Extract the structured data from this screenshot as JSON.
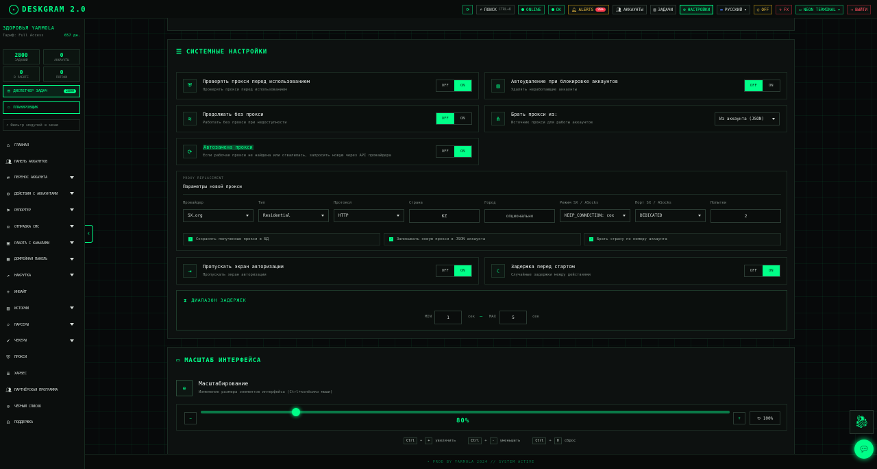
{
  "app": {
    "title": "DESKGRAM 2.0"
  },
  "topbar": {
    "search": "ПОИСК",
    "search_kbd": "CTRL+K",
    "online": "ONLINE",
    "ok": "OK",
    "alerts": "ALERTS",
    "alerts_badge": "99+",
    "accounts": "АККАУНТЫ",
    "tasks": "ЗАДАЧИ",
    "settings": "НАСТРОЙКИ",
    "language": "РУССКИЙ",
    "off": "OFF",
    "fx": "FX",
    "theme": "NEON TERMINAL",
    "logout": "ВЫЙТИ"
  },
  "sidebar": {
    "user": "ЗДОРОВЬЯ YARMOLA",
    "tariff": "Тариф: Full Access",
    "days": "657 дн.",
    "stats": [
      {
        "value": "2800",
        "label": "ЗАДАНИЙ"
      },
      {
        "value": "0",
        "label": "АККАУНТЫ"
      },
      {
        "value": "0",
        "label": "В РАБОТЕ"
      },
      {
        "value": "0",
        "label": "ПОТОКИ"
      }
    ],
    "dispatcher": "ДИСПЕТЧЕР ЗАДАЧ",
    "dispatcher_badge": "2800",
    "scheduler": "ПЛАНИРОВЩИК",
    "filter_placeholder": "Фильтр модулей в меню",
    "nav": [
      "ГЛАВНАЯ",
      "ПАНЕЛЬ АККАУНТОВ",
      "ПЕРЕНОС АККАУНТА",
      "ДЕЙСТВИЯ С АККАУНТАМИ",
      "РЕПОРТЕР",
      "ОТПРАВКА СМС",
      "РАБОТА С КАНАЛАМИ",
      "ДОМРЕЙНАЯ ПАНЕЛЬ",
      "НАКРУТКА",
      "ИНВАЙТ",
      "ИСТОРИИ",
      "ПАРСЕРЫ",
      "ЧЕКЕРЫ",
      "ПРОКСИ",
      "ХАРВЕС",
      "ПАРТНЁРСКАЯ ПРОГРАММА",
      "ЧЁРНЫЙ СПИСОК",
      "ПОДДЕРЖКА"
    ]
  },
  "system": {
    "title": "СИСТЕМНЫЕ НАСТРОЙКИ",
    "cards": [
      {
        "title": "Проверять прокси перед использованием",
        "sub": "Проверять прокси перед использованием",
        "off": "OFF",
        "on": "ON",
        "state": "on"
      },
      {
        "title": "Автоудаление при блокировке аккаунтов",
        "sub": "Удалять неработающие аккаунты",
        "off": "OFF",
        "on": "ON",
        "state": "off"
      },
      {
        "title": "Продолжать без прокси",
        "sub": "Работать без прокси при недоступности",
        "off": "OFF",
        "on": "ON",
        "state": "off"
      },
      {
        "title": "Брать прокси из:",
        "sub": "Источник прокси для работы аккаунтов",
        "select": "Из аккаунта (JSON)"
      },
      {
        "title": "Автозамена прокси",
        "sub": "Если рабочая прокси не найдена или отвалилась, запросить новую через API провайдера",
        "off": "OFF",
        "on": "ON",
        "state": "on"
      }
    ],
    "replacement": {
      "tag": "PROXY REPLACEMENT",
      "title": "Параметры новой прокси",
      "fields": [
        {
          "label": "Провайдер",
          "value": "SX.org"
        },
        {
          "label": "Тип",
          "value": "Residential"
        },
        {
          "label": "Протокол",
          "value": "HTTP"
        },
        {
          "label": "Страна",
          "value": "KZ"
        },
        {
          "label": "Город",
          "value": "опционально"
        },
        {
          "label": "Режим SX / ASocks",
          "value": "KEEP_CONNECTION: cox"
        },
        {
          "label": "Порт SX / ASocks",
          "value": "DEDICATED"
        },
        {
          "label": "Попытки",
          "value": "2"
        }
      ],
      "checks": [
        "Сохранять полученные прокси в БД",
        "Записывать новую прокси в JSON аккаунта",
        "Брать страну по номеру аккаунта"
      ]
    },
    "auth": {
      "title": "Пропускать экран авторизации",
      "sub": "Пропускать экран авторизации",
      "off": "OFF",
      "on": "ON",
      "state": "on"
    },
    "delay": {
      "title": "Задержка перед стартом",
      "sub": "Случайные задержки между действиями",
      "off": "OFF",
      "on": "ON",
      "state": "on"
    },
    "range": {
      "title": "ДИАПАЗОН ЗАДЕРЖЕК",
      "min_label": "MIN",
      "min": "1",
      "unit": "сек",
      "dash": "—",
      "max_label": "MAX",
      "max": "5"
    }
  },
  "scale": {
    "title": "МАСШТАБ ИНТЕРФЕЙСА",
    "heading": "Масштабирование",
    "sub": "Изменение размера элементов интерфейса (Ctrl+колёсико мыши)",
    "value": "80%",
    "level": 0.18,
    "reset": "100%",
    "hints": [
      {
        "k1": "Ctrl",
        "k2": "+",
        "text": "увеличить"
      },
      {
        "k1": "Ctrl",
        "k2": "-",
        "text": "уменьшить"
      },
      {
        "k1": "Ctrl",
        "k2": "0",
        "text": "сброс"
      }
    ],
    "plus": "+"
  },
  "footer": "• PROD BY YARMOLA 2024   // SYSTEM ACTIVE",
  "colors": {
    "accent": "#00ff88",
    "bg": "#07090a",
    "danger": "#ff4d5e",
    "warn": "#f3c242"
  }
}
